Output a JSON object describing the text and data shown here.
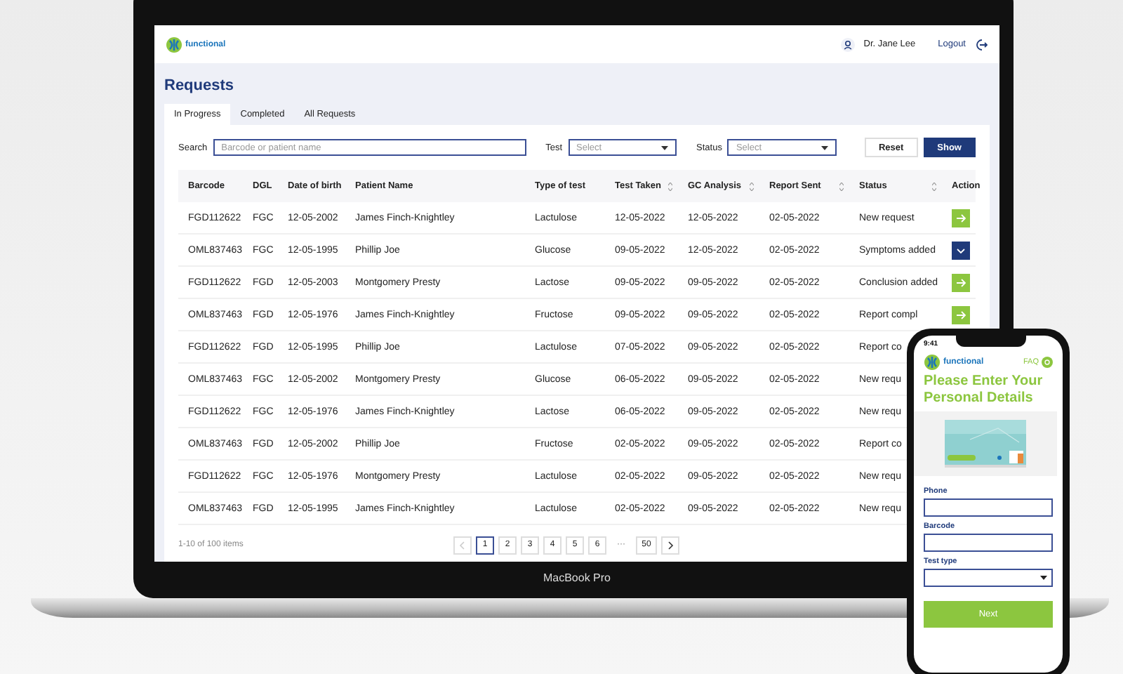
{
  "brand": "functional",
  "header": {
    "user": "Dr. Jane Lee",
    "logout": "Logout"
  },
  "page_title": "Requests",
  "tabs": [
    {
      "label": "In Progress",
      "selected": true
    },
    {
      "label": "Completed",
      "selected": false
    },
    {
      "label": "All Requests",
      "selected": false
    }
  ],
  "filters": [
    {
      "kind": "search",
      "label": "Search",
      "placeholder": "Barcode or patient name"
    },
    {
      "kind": "select",
      "label": "Test",
      "placeholder": "Select"
    },
    {
      "kind": "select",
      "label": "Status",
      "placeholder": "Select"
    }
  ],
  "buttons": [
    {
      "label": "Reset",
      "kind": "secondary"
    },
    {
      "label": "Show",
      "kind": "primary"
    }
  ],
  "table": {
    "columns": [
      {
        "label": "Barcode",
        "sortable": false
      },
      {
        "label": "DGL",
        "sortable": false
      },
      {
        "label": "Date of birth",
        "sortable": false
      },
      {
        "label": "Patient Name",
        "sortable": false
      },
      {
        "label": "Type of test",
        "sortable": false
      },
      {
        "label": "Test Taken",
        "sortable": true
      },
      {
        "label": "GC Analysis",
        "sortable": true
      },
      {
        "label": "Report Sent",
        "sortable": true
      },
      {
        "label": "Status",
        "sortable": true
      },
      {
        "label": "Action",
        "sortable": false
      }
    ],
    "rows": [
      {
        "cells": [
          "FGD112622",
          "FGC",
          "12-05-2002",
          "James Finch-Knightley",
          "Lactulose",
          "12-05-2022",
          "12-05-2022",
          "02-05-2022",
          "New request"
        ],
        "action": {
          "kind": "next"
        }
      },
      {
        "cells": [
          "OML837463",
          "FGC",
          "12-05-1995",
          "Phillip Joe",
          "Glucose",
          "09-05-2022",
          "12-05-2022",
          "02-05-2022",
          "Symptoms added"
        ],
        "action": {
          "kind": "expand"
        }
      },
      {
        "cells": [
          "FGD112622",
          "FGD",
          "12-05-2003",
          "Montgomery Presty",
          "Lactose",
          "09-05-2022",
          "09-05-2022",
          "02-05-2022",
          "Conclusion added"
        ],
        "action": {
          "kind": "next"
        }
      },
      {
        "cells": [
          "OML837463",
          "FGD",
          "12-05-1976",
          "James Finch-Knightley",
          "Fructose",
          "09-05-2022",
          "09-05-2022",
          "02-05-2022",
          "Report compl"
        ],
        "action": {
          "kind": "next"
        }
      },
      {
        "cells": [
          "FGD112622",
          "FGD",
          "12-05-1995",
          "Phillip Joe",
          "Lactulose",
          "07-05-2022",
          "09-05-2022",
          "02-05-2022",
          "Report co"
        ]
      },
      {
        "cells": [
          "OML837463",
          "FGC",
          "12-05-2002",
          "Montgomery Presty",
          "Glucose",
          "06-05-2022",
          "09-05-2022",
          "02-05-2022",
          "New requ"
        ]
      },
      {
        "cells": [
          "FGD112622",
          "FGC",
          "12-05-1976",
          "James Finch-Knightley",
          "Lactose",
          "06-05-2022",
          "09-05-2022",
          "02-05-2022",
          "New requ"
        ]
      },
      {
        "cells": [
          "OML837463",
          "FGD",
          "12-05-2002",
          "Phillip Joe",
          "Fructose",
          "02-05-2022",
          "09-05-2022",
          "02-05-2022",
          "Report co"
        ]
      },
      {
        "cells": [
          "FGD112622",
          "FGC",
          "12-05-1976",
          "Montgomery Presty",
          "Lactulose",
          "02-05-2022",
          "09-05-2022",
          "02-05-2022",
          "New requ"
        ]
      },
      {
        "cells": [
          "OML837463",
          "FGD",
          "12-05-1995",
          "James Finch-Knightley",
          "Lactulose",
          "02-05-2022",
          "09-05-2022",
          "02-05-2022",
          "New requ"
        ]
      }
    ]
  },
  "pagination": {
    "summary": "1-10 of 100 items",
    "prev_disabled": true,
    "pages": [
      {
        "label": "1",
        "selected": true
      },
      {
        "label": "2",
        "selected": false
      },
      {
        "label": "3",
        "selected": false
      },
      {
        "label": "4",
        "selected": false
      },
      {
        "label": "5",
        "selected": false
      },
      {
        "label": "6",
        "selected": false
      },
      {
        "label": "···",
        "kind": "ellipsis"
      },
      {
        "label": "50",
        "selected": false
      }
    ]
  },
  "laptop_label": "MacBook Pro",
  "phone": {
    "time": "9:41",
    "brand": "functional",
    "faq": "FAQ",
    "heading": "Please Enter Your Personal Details",
    "fields": [
      {
        "label": "Phone",
        "kind": "text"
      },
      {
        "label": "Barcode",
        "kind": "text"
      },
      {
        "label": "Test type",
        "kind": "select"
      }
    ],
    "button": "Next"
  }
}
